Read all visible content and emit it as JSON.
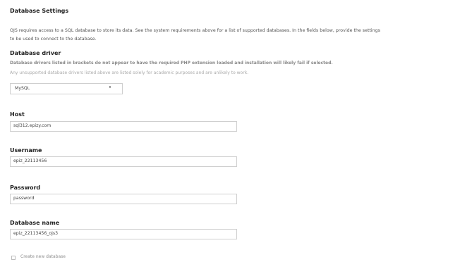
{
  "section": {
    "title": "Database Settings",
    "intro_line1": "OJS requires access to a SQL database to store its data. See the system requirements above for a list of supported databases. In the fields below, provide the settings",
    "intro_line2": "to be used to connect to the database."
  },
  "driver": {
    "label": "Database driver",
    "hint_bold": "Database drivers listed in brackets do not appear to have the required PHP extension loaded and installation will likely fail if selected.",
    "hint": "Any unsupported database drivers listed above are listed solely for academic purposes and are unlikely to work.",
    "selected": "MySQL"
  },
  "host": {
    "label": "Host",
    "value": "sql312.epizy.com"
  },
  "username": {
    "label": "Username",
    "value": "epiz_22113456"
  },
  "password": {
    "label": "Password",
    "value": "password"
  },
  "database_name": {
    "label": "Database name",
    "value": "epiz_22113456_ojs3"
  },
  "create_db": {
    "label": "Create new database",
    "checked": false
  },
  "icons": {
    "select_arrow": "dropdown-arrow-icon",
    "checkbox": "checkbox-icon"
  }
}
